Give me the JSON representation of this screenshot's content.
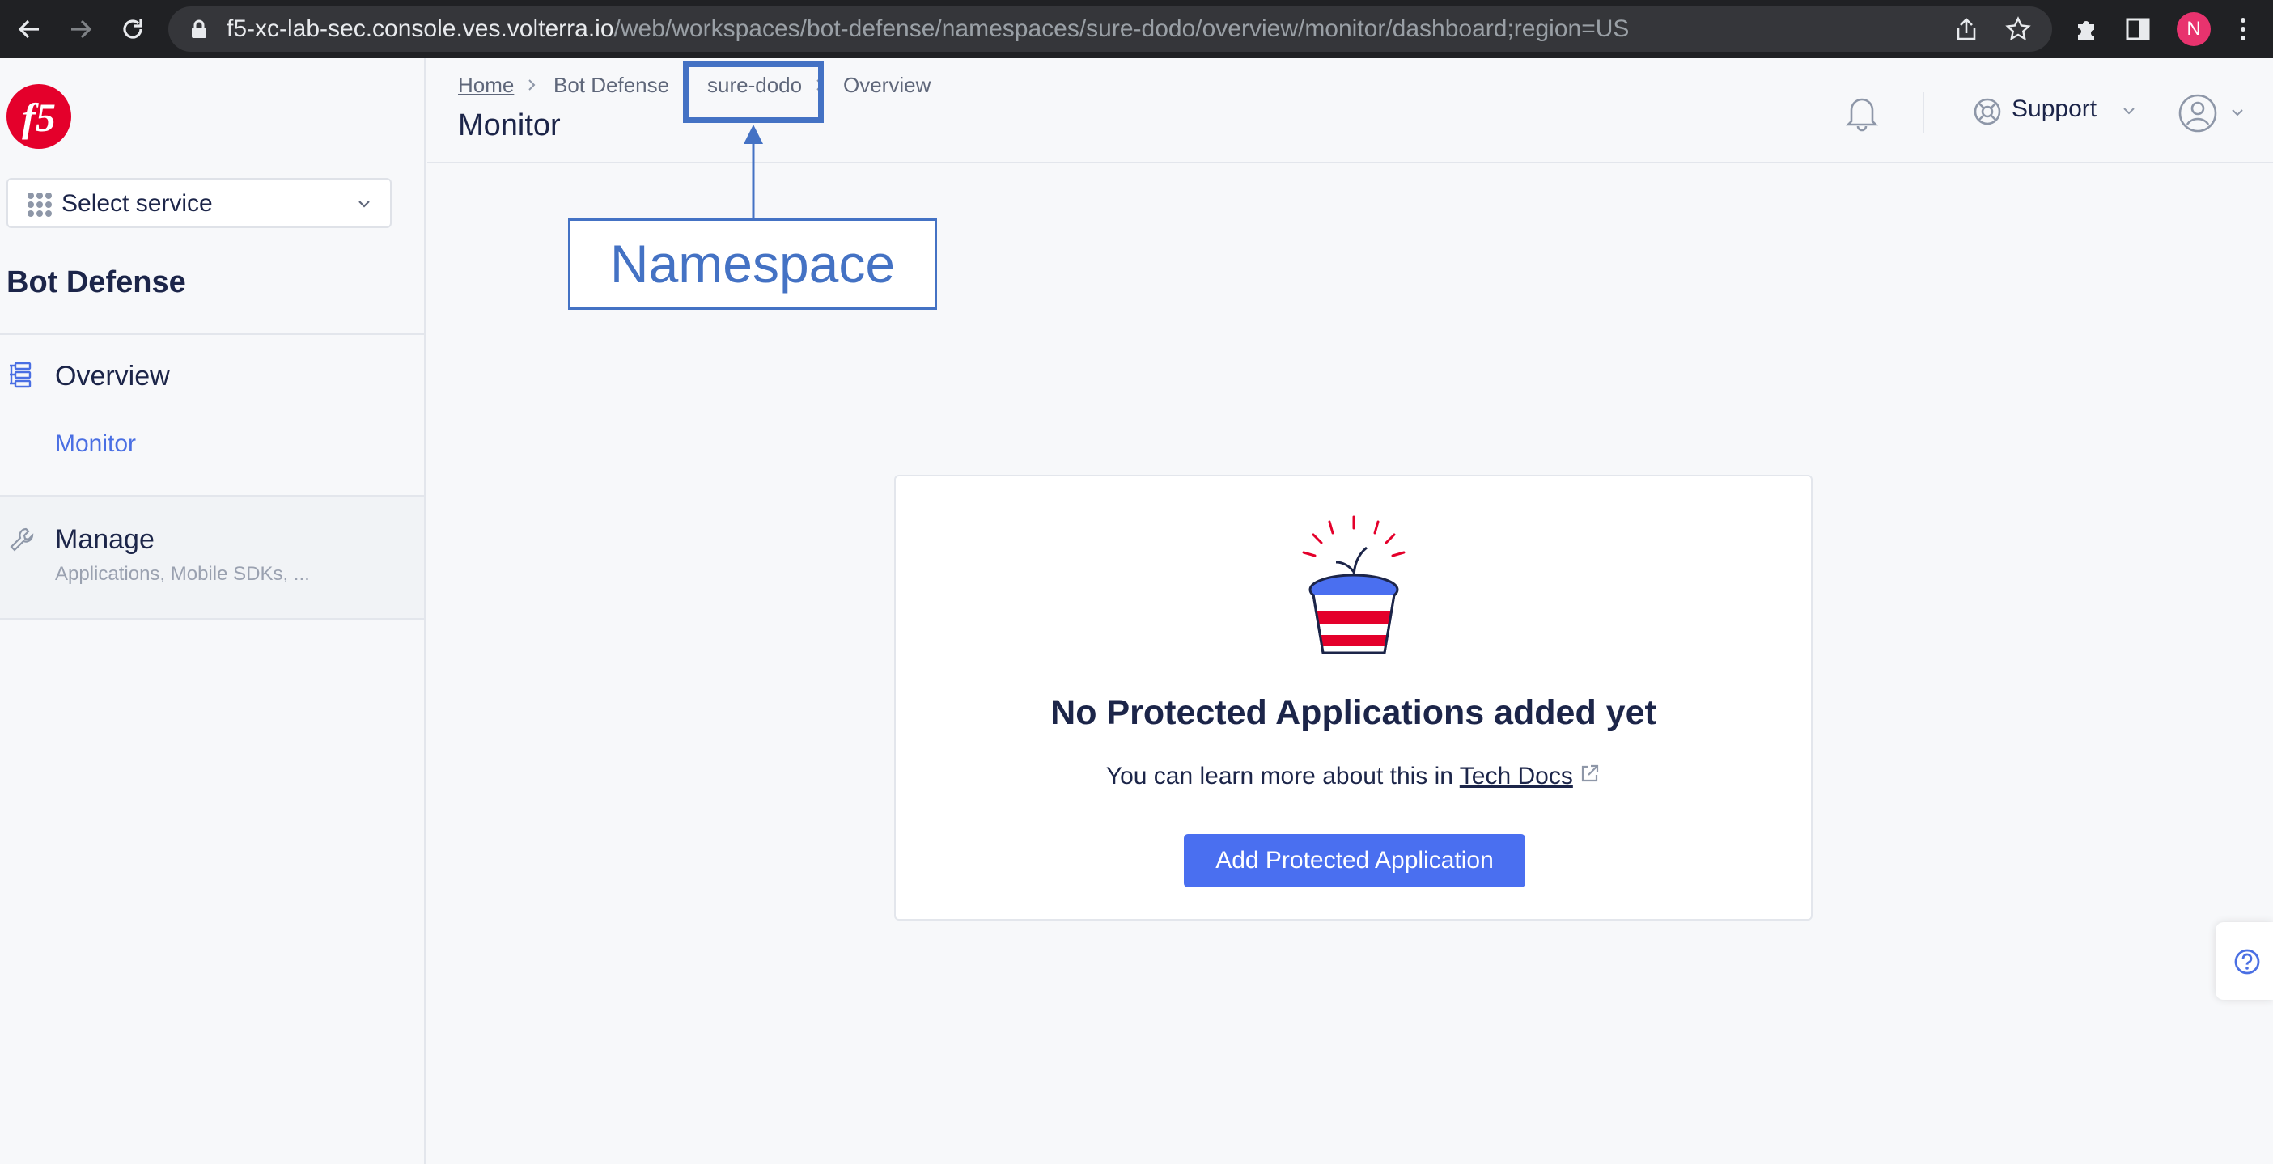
{
  "browser": {
    "url_host": "f5-xc-lab-sec.console.ves.volterra.io",
    "url_path": "/web/workspaces/bot-defense/namespaces/sure-dodo/overview/monitor/dashboard;region=US",
    "profile_initial": "N"
  },
  "sidebar": {
    "service_select": "Select service",
    "section_title": "Bot Defense",
    "overview": {
      "label": "Overview",
      "sub": "Monitor"
    },
    "manage": {
      "label": "Manage",
      "desc": "Applications, Mobile SDKs, ..."
    }
  },
  "header": {
    "breadcrumb": [
      "Home",
      "Bot Defense",
      "sure-dodo",
      "Overview"
    ],
    "title": "Monitor",
    "support": "Support"
  },
  "annotation": {
    "label": "Namespace",
    "color": "#4472c4"
  },
  "empty_state": {
    "title": "No Protected Applications added yet",
    "text_prefix": "You can learn more about this in",
    "link": "Tech Docs",
    "button": "Add Protected Application"
  },
  "colors": {
    "accent": "#4a6ff0",
    "brand_red": "#e4002b"
  }
}
